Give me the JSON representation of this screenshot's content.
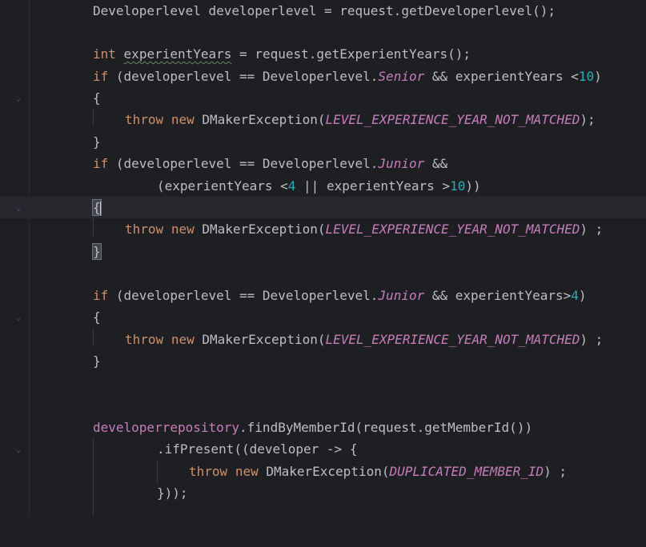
{
  "editor": {
    "lines": [
      {
        "id": "l1",
        "tokens": [
          "Developerlevel developerlevel = request.getDeveloperlevel();"
        ]
      },
      {
        "id": "l3",
        "tokens": [
          "int",
          " ",
          "experientYears",
          " = request.getExperientYears();"
        ]
      },
      {
        "id": "l4",
        "tokens": [
          "if",
          " (developerlevel == Developerlevel.",
          "Senior",
          " && experientYears <",
          "10",
          ")"
        ]
      },
      {
        "id": "l5",
        "tokens": [
          "{"
        ]
      },
      {
        "id": "l6",
        "tokens": [
          "throw",
          " ",
          "new",
          " DMakerException(",
          "LEVEL_EXPERIENCE_YEAR_NOT_MATCHED",
          ");"
        ]
      },
      {
        "id": "l7",
        "tokens": [
          "}"
        ]
      },
      {
        "id": "l8",
        "tokens": [
          "if",
          " (developerlevel == Developerlevel.",
          "Junior",
          " &&"
        ]
      },
      {
        "id": "l9",
        "tokens": [
          "(experientYears <",
          "4",
          " || experientYears >",
          "10",
          "))"
        ]
      },
      {
        "id": "l10",
        "tokens": [
          "{"
        ]
      },
      {
        "id": "l11",
        "tokens": [
          "throw",
          " ",
          "new",
          " DMakerException(",
          "LEVEL_EXPERIENCE_YEAR_NOT_MATCHED",
          ") ;"
        ]
      },
      {
        "id": "l12",
        "tokens": [
          "}"
        ]
      },
      {
        "id": "l14",
        "tokens": [
          "if",
          " (developerlevel == Developerlevel.",
          "Junior",
          " && experientYears>",
          "4",
          ")"
        ]
      },
      {
        "id": "l15",
        "tokens": [
          "{"
        ]
      },
      {
        "id": "l16",
        "tokens": [
          "throw",
          " ",
          "new",
          " DMakerException(",
          "LEVEL_EXPERIENCE_YEAR_NOT_MATCHED",
          ") ;"
        ]
      },
      {
        "id": "l17",
        "tokens": [
          "}"
        ]
      },
      {
        "id": "l20",
        "tokens": [
          "developerrepository",
          ".findByMemberId(request.getMemberId())"
        ]
      },
      {
        "id": "l21",
        "tokens": [
          ".ifPresent((developer -> {"
        ]
      },
      {
        "id": "l22",
        "tokens": [
          "throw",
          " ",
          "new",
          " DMakerException(",
          "DUPLICATED_MEMBER_ID",
          ") ;"
        ]
      },
      {
        "id": "l23",
        "tokens": [
          "}));"
        ]
      }
    ],
    "fold_icon": "chevron-down-icon",
    "colors": {
      "background": "#1e1f22",
      "current_line": "#26282e",
      "keyword": "#cf8e6d",
      "number": "#2aacb8",
      "field": "#c77dbb",
      "text": "#bcbec4"
    }
  }
}
